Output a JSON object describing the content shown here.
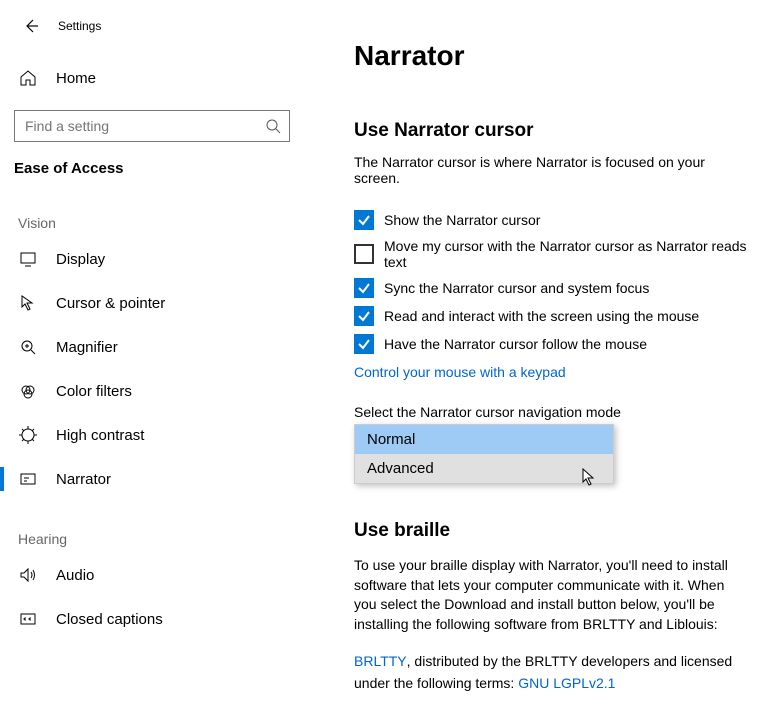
{
  "header": {
    "app_title": "Settings",
    "home_label": "Home",
    "search_placeholder": "Find a setting",
    "section": "Ease of Access"
  },
  "sidebar": {
    "groups": [
      {
        "label": "Vision",
        "items": [
          {
            "label": "Display",
            "icon": "display-icon",
            "active": false
          },
          {
            "label": "Cursor & pointer",
            "icon": "cursor-pointer-icon",
            "active": false
          },
          {
            "label": "Magnifier",
            "icon": "magnifier-icon",
            "active": false
          },
          {
            "label": "Color filters",
            "icon": "color-filters-icon",
            "active": false
          },
          {
            "label": "High contrast",
            "icon": "high-contrast-icon",
            "active": false
          },
          {
            "label": "Narrator",
            "icon": "narrator-icon",
            "active": true
          }
        ]
      },
      {
        "label": "Hearing",
        "items": [
          {
            "label": "Audio",
            "icon": "audio-icon",
            "active": false
          },
          {
            "label": "Closed captions",
            "icon": "closed-captions-icon",
            "active": false
          }
        ]
      }
    ]
  },
  "page": {
    "title": "Narrator",
    "section1": {
      "heading": "Use Narrator cursor",
      "desc": "The Narrator cursor is where Narrator is focused on your screen.",
      "checks": [
        {
          "label": "Show the Narrator cursor",
          "checked": true
        },
        {
          "label": "Move my cursor with the Narrator cursor as Narrator reads text",
          "checked": false
        },
        {
          "label": "Sync the Narrator cursor and system focus",
          "checked": true
        },
        {
          "label": "Read and interact with the screen using the mouse",
          "checked": true
        },
        {
          "label": "Have the Narrator cursor follow the mouse",
          "checked": true
        }
      ],
      "link": "Control your mouse with a keypad",
      "select_label": "Select the Narrator cursor navigation mode",
      "options": [
        "Normal",
        "Advanced"
      ],
      "selected": "Normal"
    },
    "section2": {
      "heading": "Use braille",
      "p1": "To use your braille display with Narrator, you'll need to install software that lets your computer communicate with it. When you select the Download and install button below, you'll be installing the following software from BRLTTY and Liblouis:",
      "p2_pre": "",
      "brltty_link": "BRLTTY",
      "p2_mid": ", distributed by the BRLTTY developers and licensed under the following terms: ",
      "lgpl_link": "GNU LGPLv2.1"
    }
  }
}
